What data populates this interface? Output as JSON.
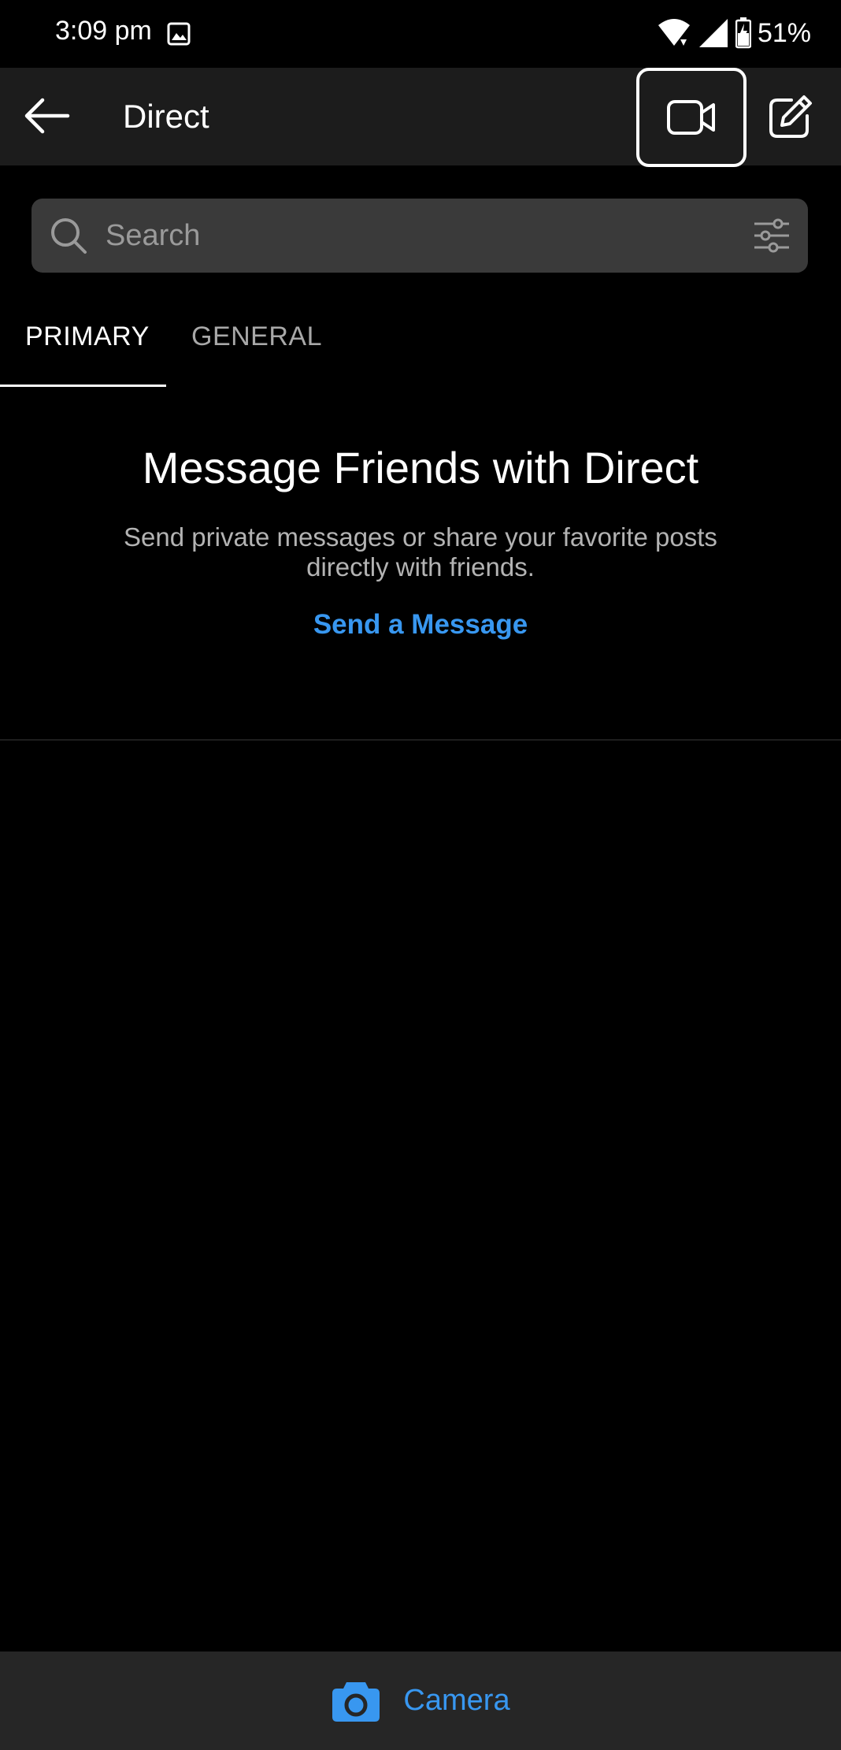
{
  "status_bar": {
    "time": "3:09 pm",
    "battery_percent": "51%",
    "icons": [
      "gallery-icon",
      "wifi-icon",
      "signal-icon",
      "battery-charging-icon"
    ]
  },
  "header": {
    "title": "Direct",
    "icons": [
      "back-arrow-icon",
      "video-camera-icon",
      "compose-icon"
    ]
  },
  "search": {
    "placeholder": "Search",
    "icons": [
      "search-icon",
      "filter-icon"
    ]
  },
  "tabs": [
    {
      "label": "PRIMARY",
      "active": true
    },
    {
      "label": "GENERAL",
      "active": false
    }
  ],
  "empty_state": {
    "title": "Message Friends with Direct",
    "body": "Send private messages or share your favorite posts directly with friends.",
    "link": "Send a Message"
  },
  "bottom_bar": {
    "label": "Camera",
    "icon": "camera-icon"
  },
  "colors": {
    "accent": "#3897f0",
    "header_bg": "#1c1c1c",
    "search_bg": "#3a3a3a",
    "bottom_bar_bg": "#262626"
  }
}
